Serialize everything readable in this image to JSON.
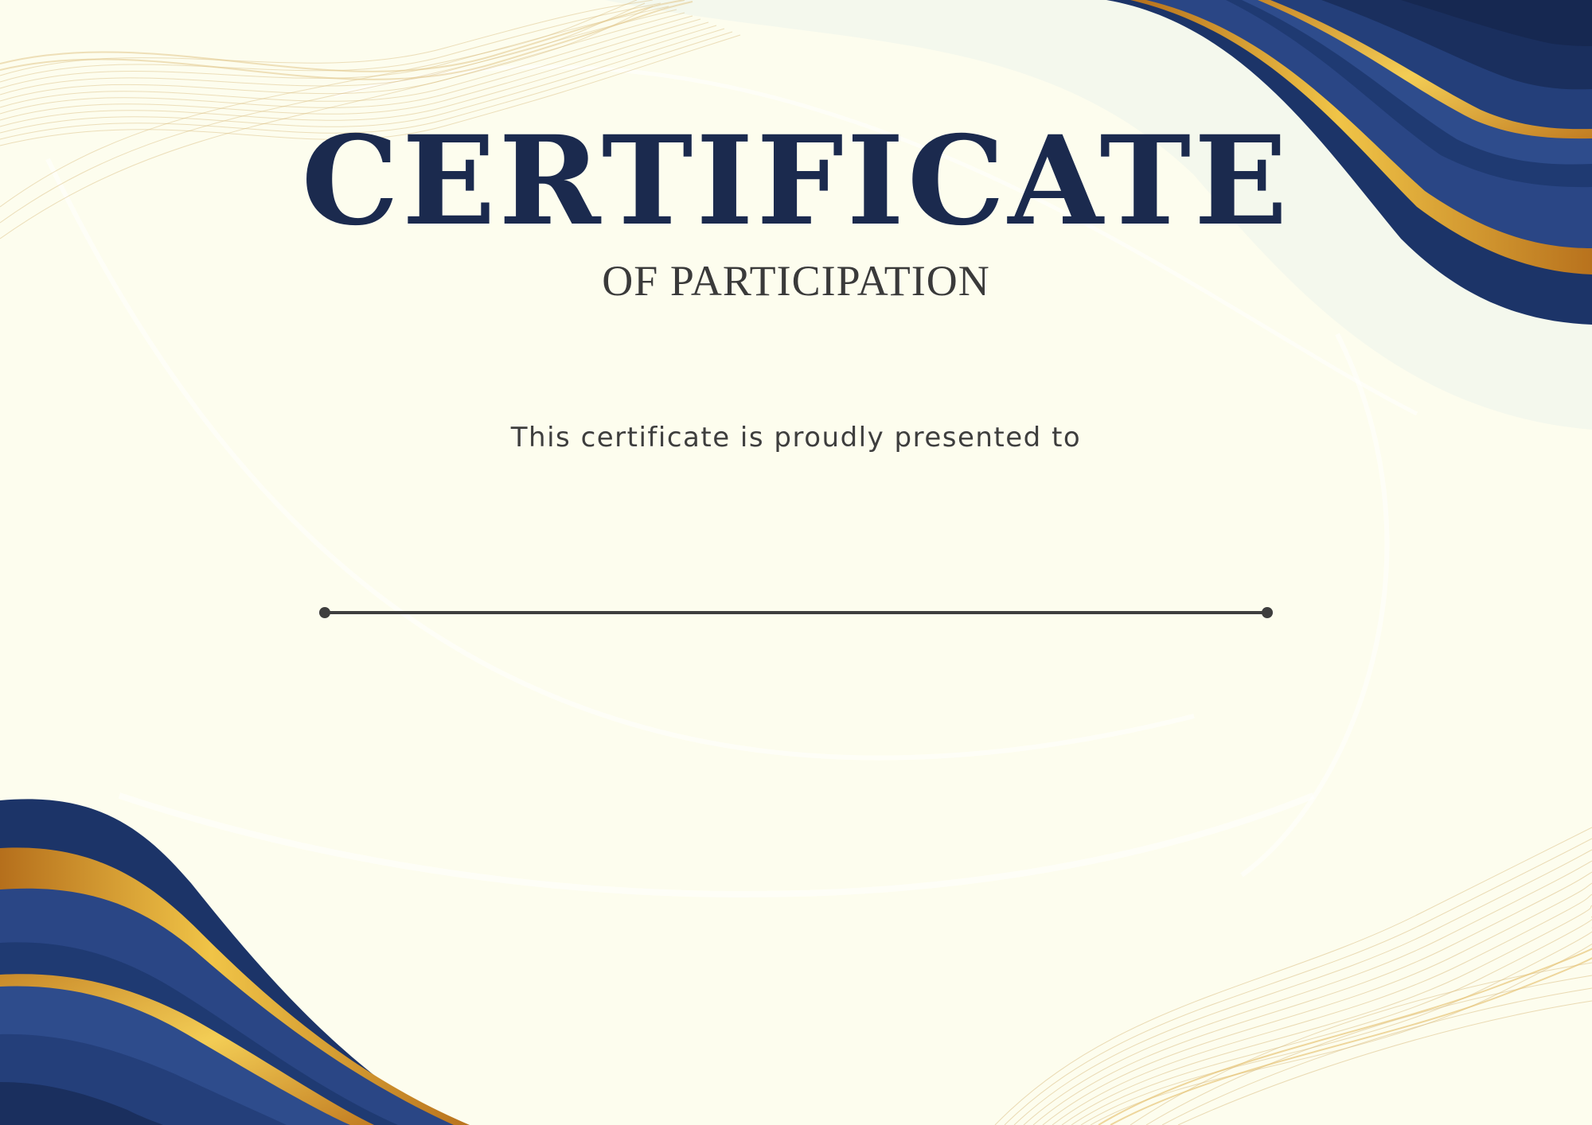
{
  "certificate": {
    "title": "CERTIFICATE",
    "subtitle": "OF PARTICIPATION",
    "presented_text": "This certificate is proudly presented to",
    "recipient_name": ""
  },
  "colors": {
    "background": "#fdfdee",
    "navy": "#1b2a4e",
    "royal_blue": "#2a4685",
    "gold": "#e6b43c",
    "dark_gold": "#b8741e",
    "text_dark": "#3a3a3a"
  }
}
